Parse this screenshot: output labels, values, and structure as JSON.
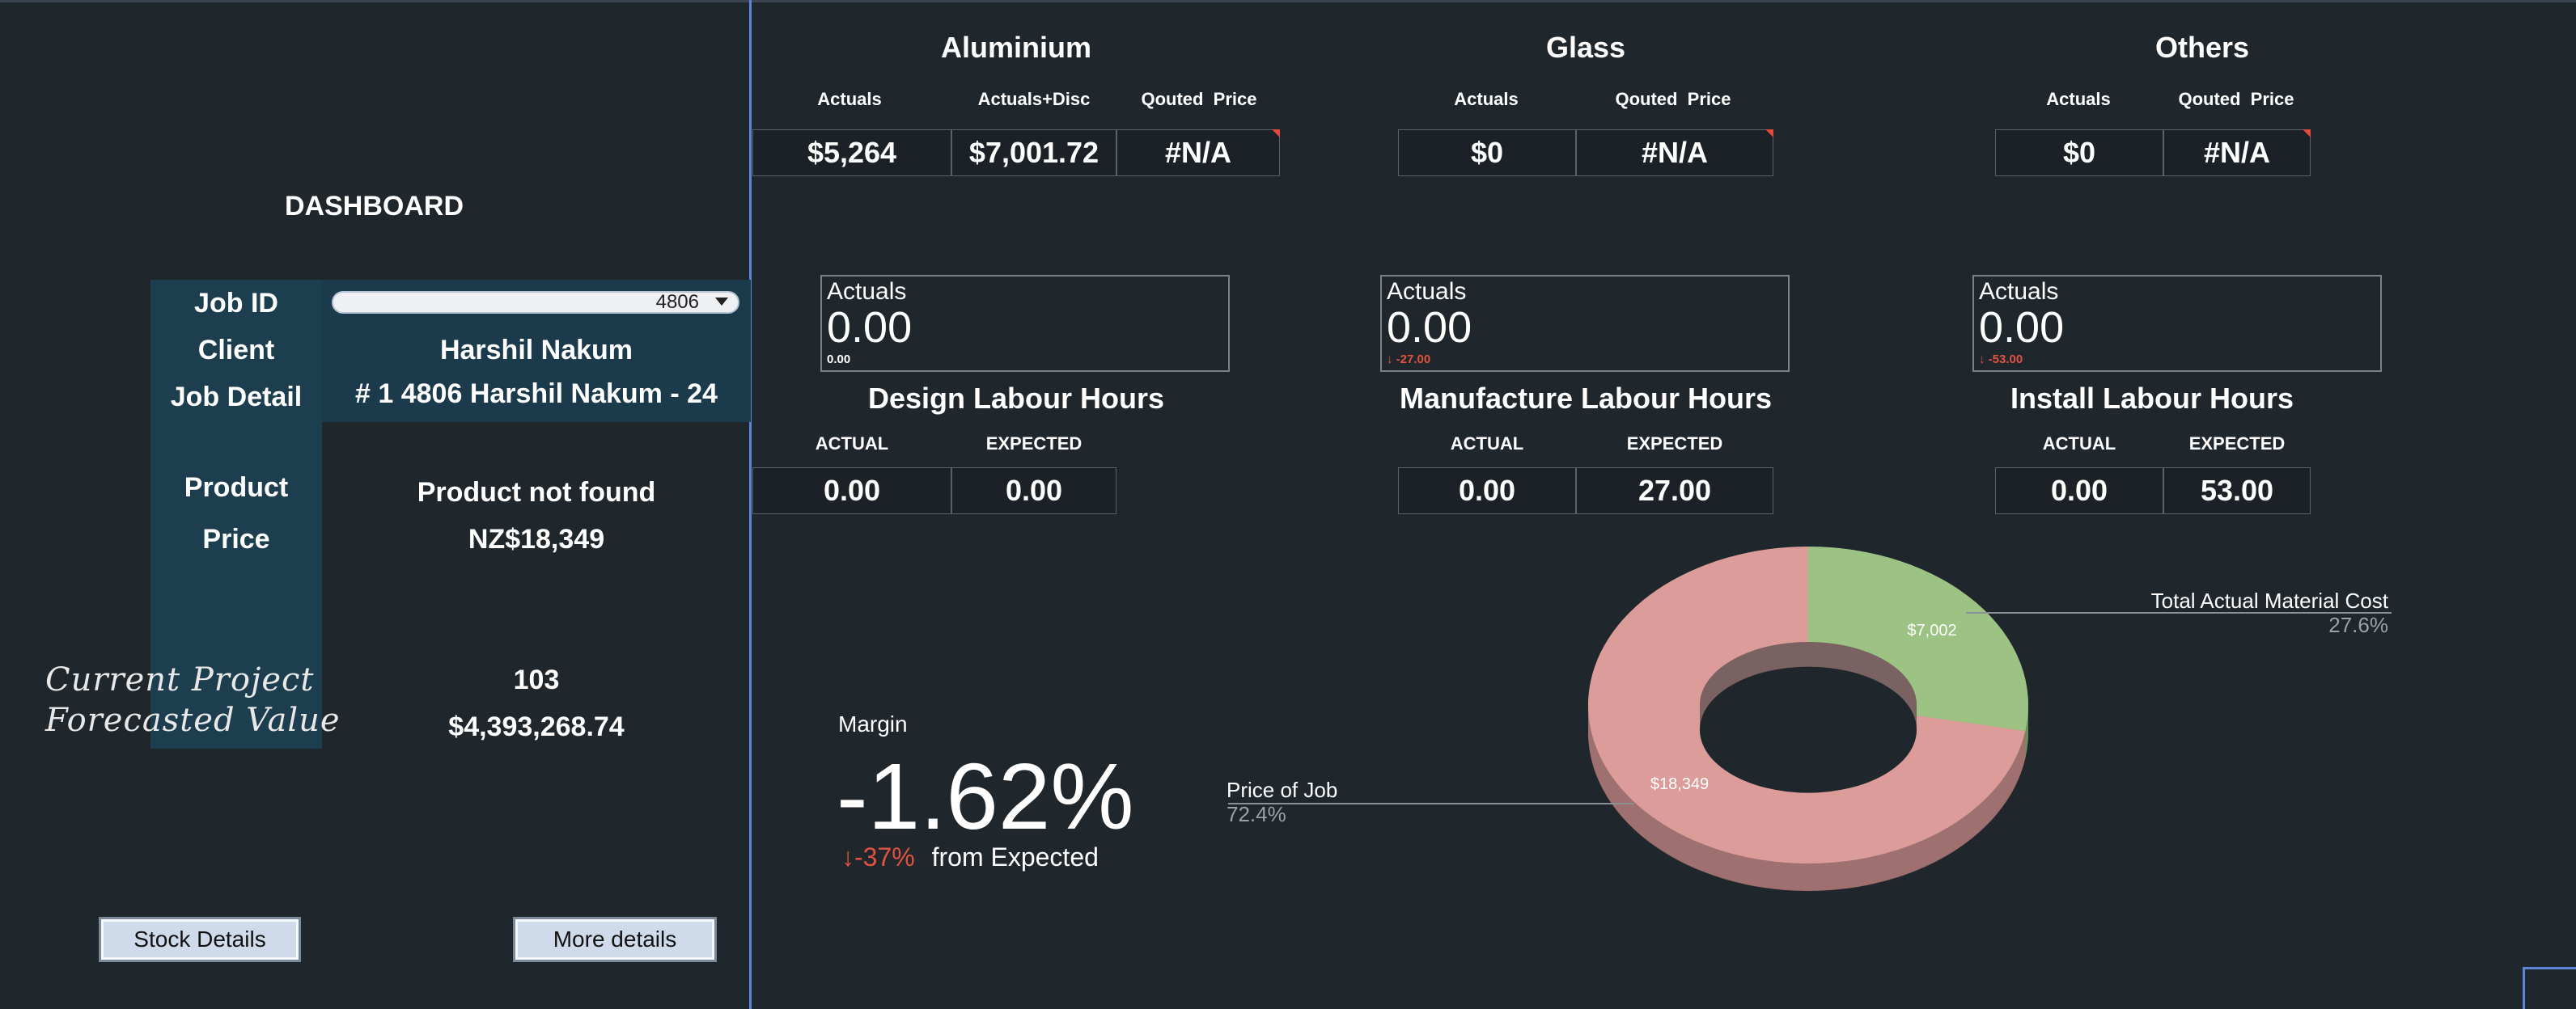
{
  "left_panel": {
    "title": "DASHBOARD",
    "job_id_label": "Job ID",
    "job_id_value": "4806",
    "client_label": "Client",
    "client_value": "Harshil Nakum",
    "job_detail_label": "Job Detail",
    "job_detail_value": "# 1 4806 Harshil Nakum - 24",
    "product_label": "Product",
    "product_value": "Product not found",
    "price_label": "Price",
    "price_value": "NZ$18,349",
    "forecast_label_line1": "Current Project",
    "forecast_label_line2": "Forecasted Value",
    "project_count": "103",
    "forecast_value": "$4,393,268.74",
    "buttons": {
      "stock_details": "Stock Details",
      "more_details": "More details"
    }
  },
  "materials": {
    "aluminium": {
      "title": "Aluminium",
      "headers": [
        "Actuals",
        "Actuals+Disc",
        "Qouted  Price"
      ],
      "values": [
        "$5,264",
        "$7,001.72",
        "#N/A"
      ]
    },
    "glass": {
      "title": "Glass",
      "headers": [
        "Actuals",
        "Qouted  Price"
      ],
      "values": [
        "$0",
        "#N/A"
      ]
    },
    "others": {
      "title": "Others",
      "headers": [
        "Actuals",
        "Qouted  Price"
      ],
      "values": [
        "$0",
        "#N/A"
      ]
    }
  },
  "labour": {
    "design": {
      "kpi_label": "Actuals",
      "kpi_value": "0.00",
      "kpi_delta": "0.00",
      "title": "Design Labour Hours",
      "headers": [
        "ACTUAL",
        "EXPECTED"
      ],
      "values": [
        "0.00",
        "0.00"
      ]
    },
    "manufacture": {
      "kpi_label": "Actuals",
      "kpi_value": "0.00",
      "kpi_delta": "↓ -27.00",
      "title": "Manufacture Labour Hours",
      "headers": [
        "ACTUAL",
        "EXPECTED"
      ],
      "values": [
        "0.00",
        "27.00"
      ]
    },
    "install": {
      "kpi_label": "Actuals",
      "kpi_value": "0.00",
      "kpi_delta": "↓ -53.00",
      "title": "Install Labour Hours",
      "headers": [
        "ACTUAL",
        "EXPECTED"
      ],
      "values": [
        "0.00",
        "53.00"
      ]
    }
  },
  "margin": {
    "label": "Margin",
    "value": "-1.62%",
    "delta": "↓-37%",
    "delta_suffix": "from Expected"
  },
  "colors": {
    "background": "#1f262c",
    "accent_divider": "#5b86d6",
    "negative": "#e2533f",
    "donut_price": "#dc9c9a",
    "donut_material": "#9dc384"
  },
  "chart_data": {
    "type": "pie",
    "style": "3d-donut",
    "categories": [
      "Price of Job",
      "Total Actual Material Cost"
    ],
    "values": [
      18349,
      7002
    ],
    "data_labels": [
      "$18,349",
      "$7,002"
    ],
    "percent_labels": [
      "72.4%",
      "27.6%"
    ],
    "colors": [
      "#dc9c9a",
      "#9dc384"
    ]
  }
}
